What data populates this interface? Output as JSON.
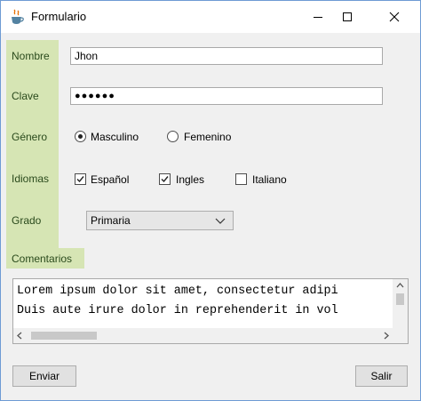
{
  "window": {
    "title": "Formulario"
  },
  "form": {
    "nombre": {
      "label": "Nombre",
      "value": "Jhon"
    },
    "clave": {
      "label": "Clave",
      "value": "●●●●●●"
    },
    "genero": {
      "label": "Género",
      "options": [
        {
          "label": "Masculino",
          "selected": true
        },
        {
          "label": "Femenino",
          "selected": false
        }
      ]
    },
    "idiomas": {
      "label": "Idiomas",
      "options": [
        {
          "label": "Español",
          "checked": true
        },
        {
          "label": "Ingles",
          "checked": true
        },
        {
          "label": "Italiano",
          "checked": false
        }
      ]
    },
    "grado": {
      "label": "Grado",
      "value": "Primaria"
    },
    "comentarios": {
      "label": "Comentarios",
      "lines": [
        "Lorem ipsum dolor sit amet, consectetur adipi",
        "Duis aute irure dolor in reprehenderit in vol"
      ]
    }
  },
  "buttons": {
    "enviar": "Enviar",
    "salir": "Salir"
  },
  "colors": {
    "label_bg": "#d6e5b4",
    "label_text": "#2a4a1c",
    "window_border": "#6e9bd4"
  }
}
